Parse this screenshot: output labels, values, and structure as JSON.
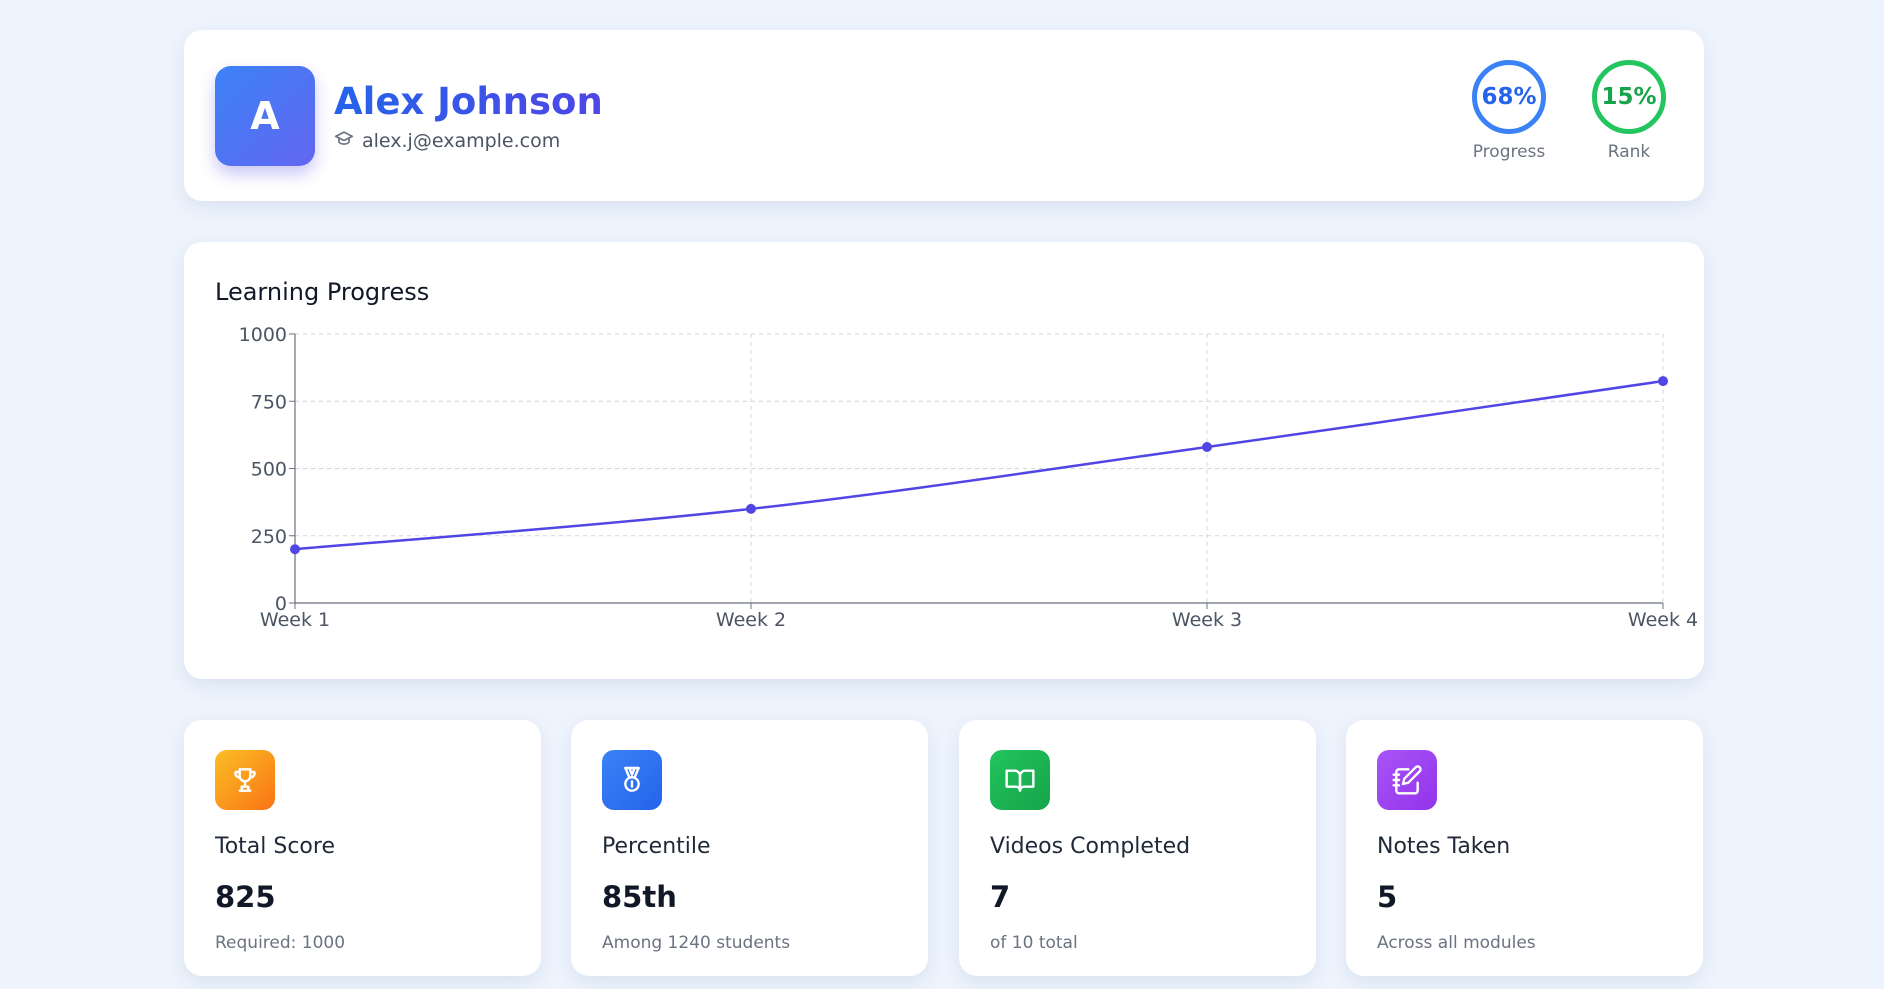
{
  "user": {
    "avatar_initial": "A",
    "name": "Alex Johnson",
    "email": "alex.j@example.com",
    "email_icon": "graduation-cap-icon"
  },
  "header_stats": [
    {
      "value": "68%",
      "label": "Progress",
      "percent": 68,
      "color": "#3b82f6"
    },
    {
      "value": "15%",
      "label": "Rank",
      "percent": 15,
      "color": "#22c55e"
    }
  ],
  "chart": {
    "title": "Learning Progress"
  },
  "chart_data": {
    "type": "line",
    "categories": [
      "Week 1",
      "Week 2",
      "Week 3",
      "Week 4"
    ],
    "series": [
      {
        "values": [
          200,
          350,
          580,
          825
        ],
        "color": "#4f46e5"
      }
    ],
    "ylim": [
      0,
      1000
    ],
    "yticks": [
      "0",
      "250",
      "500",
      "750",
      "1000"
    ],
    "grid": true,
    "legend": "none"
  },
  "stat_cards": [
    {
      "icon": "trophy-icon",
      "label": "Total Score",
      "value": "825",
      "sub": "Required: 1000",
      "color": "#f59e0b"
    },
    {
      "icon": "medal-icon",
      "label": "Percentile",
      "value": "85th",
      "sub": "Among 1240 students",
      "color": "#3b82f6"
    },
    {
      "icon": "book-open-icon",
      "label": "Videos Completed",
      "value": "7",
      "sub": "of 10 total",
      "color": "#22c55e"
    },
    {
      "icon": "notebook-pen-icon",
      "label": "Notes Taken",
      "value": "5",
      "sub": "Across all modules",
      "color": "#a855f7"
    }
  ]
}
